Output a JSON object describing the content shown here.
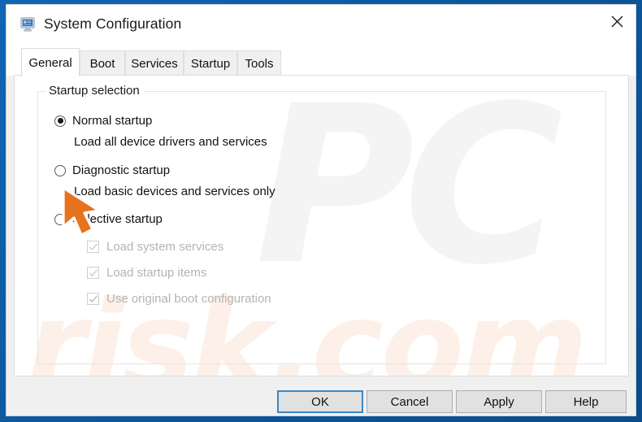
{
  "window": {
    "title": "System Configuration",
    "icon": "computer-monitor-icon",
    "close_label": "×",
    "frame_color": "#0b5a9e",
    "titlebar_bg": "#ffffff",
    "chrome_bg": "#f0f0f0"
  },
  "tabs": [
    {
      "label": "General",
      "active": true
    },
    {
      "label": "Boot",
      "active": false
    },
    {
      "label": "Services",
      "active": false
    },
    {
      "label": "Startup",
      "active": false
    },
    {
      "label": "Tools",
      "active": false
    }
  ],
  "group": {
    "legend": "Startup selection"
  },
  "startup_options": [
    {
      "label": "Normal startup",
      "description": "Load all device drivers and services",
      "selected": true
    },
    {
      "label": "Diagnostic startup",
      "description": "Load basic devices and services only",
      "selected": false
    },
    {
      "label": "Selective startup",
      "description": "",
      "selected": false
    }
  ],
  "selective_checkboxes": [
    {
      "label": "Load system services",
      "checked": true,
      "disabled": true
    },
    {
      "label": "Load startup items",
      "checked": true,
      "disabled": true
    },
    {
      "label": "Use original boot configuration",
      "checked": true,
      "disabled": true
    }
  ],
  "buttons": [
    {
      "label": "OK",
      "default": true
    },
    {
      "label": "Cancel",
      "default": false
    },
    {
      "label": "Apply",
      "default": false
    },
    {
      "label": "Help",
      "default": false
    }
  ],
  "watermarks": {
    "primary": "PC",
    "secondary": "risk.com",
    "primary_color": "#f4f4f5",
    "secondary_color": "#fdf0e8"
  },
  "cursor": {
    "type": "arrow-pointer",
    "color": "#e8731e"
  }
}
